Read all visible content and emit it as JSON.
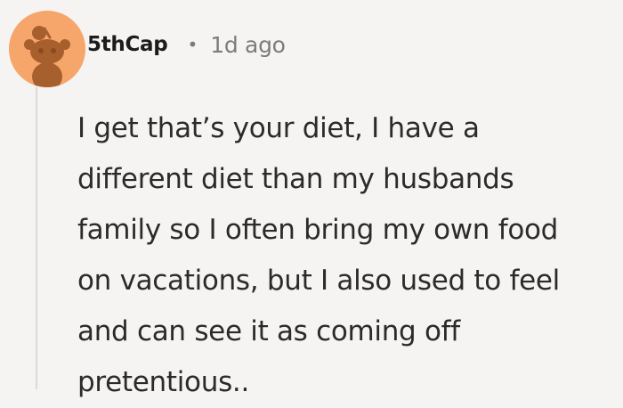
{
  "comment": {
    "author": "5thCap",
    "separator": "•",
    "timestamp": "1d ago",
    "body_lines": [
      "I get that’s your diet, I have a",
      "different diet than my husbands",
      "family so I often bring my own food",
      "on vacations, but I also used to feel",
      "and can see it as coming off",
      "pretentious.."
    ]
  },
  "avatar": {
    "icon": "snoo-avatar-icon",
    "background_color": "#f6a66a",
    "figure_color": "#a85f2e"
  },
  "colors": {
    "page_background": "#f6f4f3",
    "author_text": "#1c1c1c",
    "meta_text": "#7c7c7c",
    "body_text": "#2b2b2b",
    "thread_line": "#dcdad9"
  }
}
